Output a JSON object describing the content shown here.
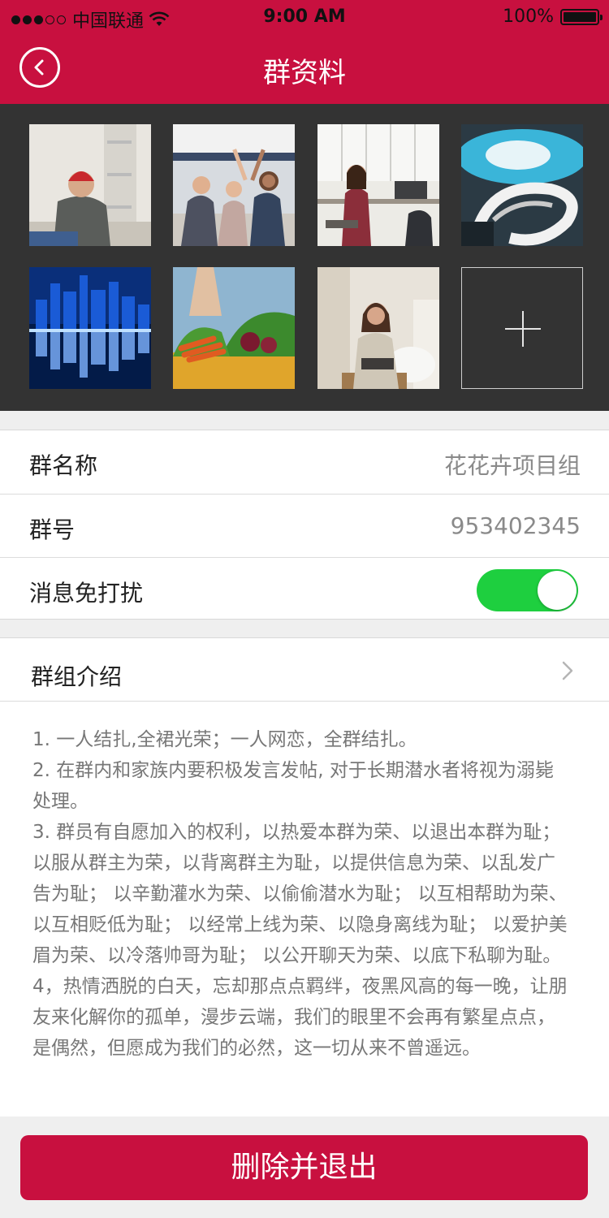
{
  "status_bar": {
    "carrier": "中国联通",
    "time": "9:00 AM",
    "battery": "100%"
  },
  "header": {
    "title": "群资料",
    "back_icon": "chevron-left-icon"
  },
  "photos": [
    {
      "name": "photo-man-red-beanie"
    },
    {
      "name": "photo-women-high-five"
    },
    {
      "name": "photo-woman-office"
    },
    {
      "name": "photo-spiral-staircase"
    },
    {
      "name": "photo-city-night"
    },
    {
      "name": "photo-vegetables"
    },
    {
      "name": "photo-woman-smiling-chair"
    }
  ],
  "add_photo_icon": "plus-icon",
  "info": {
    "group_name_label": "群名称",
    "group_name_value": "花花卉项目组",
    "group_id_label": "群号",
    "group_id_value": "953402345",
    "mute_label": "消息免打扰",
    "mute_on": true
  },
  "intro": {
    "label": "群组介绍",
    "rules": [
      "1. 一人结扎,全裙光荣；一人网恋，全群结扎。",
      "2. 在群内和家族内要积极发言发帖, 对于长期潜水者将视为溺毙处理。",
      "3. 群员有自愿加入的权利，以热爱本群为荣、以退出本群为耻； 以服从群主为荣，以背离群主为耻，以提供信息为荣、以乱发广告为耻； 以辛勤灌水为荣、以偷偷潜水为耻； 以互相帮助为荣、以互相贬低为耻； 以经常上线为荣、以隐身离线为耻； 以爱护美眉为荣、以冷落帅哥为耻； 以公开聊天为荣、以底下私聊为耻。",
      "4，热情洒脱的白天，忘却那点点羁绊，夜黑风高的每一晚，让朋友来化解你的孤单，漫步云端，我们的眼里不会再有繁星点点，是偶然，但愿成为我们的必然，这一切从来不曾遥远。"
    ]
  },
  "delete_button": "删除并退出",
  "colors": {
    "brand": "#c8103f",
    "toggle_on": "#1ecf3f"
  }
}
